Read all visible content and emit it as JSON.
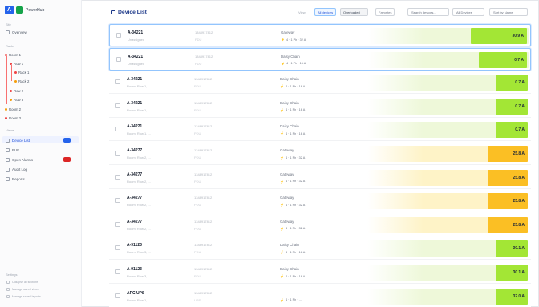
{
  "app": {
    "title": "PowerHub"
  },
  "sidebar": {
    "section_top": "Site",
    "overview": "Overview",
    "section_racks": "Racks",
    "tree": [
      {
        "label": "Room 1",
        "level": 0,
        "dot": "red",
        "count": ""
      },
      {
        "label": "Row 1",
        "level": 1,
        "dot": "red",
        "count": ""
      },
      {
        "label": "Rack 1",
        "level": 2,
        "dot": "red",
        "count": ""
      },
      {
        "label": "Rack 2",
        "level": 2,
        "dot": "orange",
        "count": ""
      },
      {
        "label": "Row 2",
        "level": 1,
        "dot": "red",
        "count": ""
      },
      {
        "label": "Row 3",
        "level": 1,
        "dot": "orange",
        "count": ""
      },
      {
        "label": "Room 2",
        "level": 0,
        "dot": "orange",
        "count": ""
      },
      {
        "label": "Room 3",
        "level": 0,
        "dot": "red",
        "count": ""
      }
    ],
    "section_views": "Views",
    "nav": [
      {
        "label": "Device List",
        "badge": "",
        "badge_color": "blue",
        "active": true
      },
      {
        "label": "PUE",
        "badge": "",
        "badge_color": "",
        "active": false
      },
      {
        "label": "Open Alarms",
        "badge": "",
        "badge_color": "red",
        "active": false
      },
      {
        "label": "Audit Log",
        "badge": "",
        "badge_color": "",
        "active": false
      },
      {
        "label": "Reports",
        "badge": "",
        "badge_color": "",
        "active": false
      }
    ],
    "section_settings": "Settings",
    "footer": [
      "Collapse all sections",
      "Manage saved views",
      "Manage saved layouts"
    ]
  },
  "header": {
    "title": "Device List",
    "view_label": "View",
    "seg_all": "All devices",
    "seg_overloaded": "Overloaded",
    "seg_overloaded_count": "",
    "seg_favorites": "Favorites",
    "search_placeholder": "Search devices...",
    "filter_label": "All Devices",
    "sort_label": "Sort by Name"
  },
  "rows": [
    {
      "name": "A-34221",
      "loc": "Unassigned",
      "serial": "1348917812",
      "sub": "PDU",
      "type": "Gateway",
      "spec": "4 · 1 Ph · 32 A",
      "value": "30.9 A",
      "fill": 0.35,
      "tone": "green",
      "selected": true
    },
    {
      "name": "A-34221",
      "loc": "Unassigned",
      "serial": "1348917812",
      "sub": "PDU",
      "type": "Daisy Chain",
      "spec": "4 · 1 Ph · 16 A",
      "value": "0.7 A",
      "fill": 0.3,
      "tone": "green",
      "selected": true
    },
    {
      "name": "A-34221",
      "loc": "Room, Row 1, ...",
      "serial": "1348917812",
      "sub": "PDU",
      "type": "Daisy Chain",
      "spec": "4 · 1 Ph · 16 A",
      "value": "0.7 A",
      "fill": 0.2,
      "tone": "green",
      "selected": false
    },
    {
      "name": "A-34221",
      "loc": "Room, Row 1, ...",
      "serial": "1348917812",
      "sub": "PDU",
      "type": "Daisy Chain",
      "spec": "4 · 1 Ph · 16 A",
      "value": "0.7 A",
      "fill": 0.2,
      "tone": "green",
      "selected": false
    },
    {
      "name": "A-34221",
      "loc": "Room, Row 1, ...",
      "serial": "1348917812",
      "sub": "PDU",
      "type": "Daisy Chain",
      "spec": "4 · 1 Ph · 16 A",
      "value": "0.7 A",
      "fill": 0.2,
      "tone": "green",
      "selected": false
    },
    {
      "name": "A-34277",
      "loc": "Room, Row 2, ...",
      "serial": "1348917812",
      "sub": "PDU",
      "type": "Gateway",
      "spec": "4 · 1 Ph · 32 A",
      "value": "25.8 A",
      "fill": 0.25,
      "tone": "yellow",
      "selected": false
    },
    {
      "name": "A-34277",
      "loc": "Room, Row 2, ...",
      "serial": "1348917812",
      "sub": "PDU",
      "type": "Gateway",
      "spec": "4 · 1 Ph · 32 A",
      "value": "25.8 A",
      "fill": 0.25,
      "tone": "yellow",
      "selected": false
    },
    {
      "name": "A-34277",
      "loc": "Room, Row 2, ...",
      "serial": "1348917812",
      "sub": "PDU",
      "type": "Gateway",
      "spec": "4 · 1 Ph · 32 A",
      "value": "25.8 A",
      "fill": 0.25,
      "tone": "yellow",
      "selected": false
    },
    {
      "name": "A-34277",
      "loc": "Room, Row 2, ...",
      "serial": "1348917812",
      "sub": "PDU",
      "type": "Gateway",
      "spec": "4 · 1 Ph · 32 A",
      "value": "25.8 A",
      "fill": 0.25,
      "tone": "yellow",
      "selected": false
    },
    {
      "name": "A-91123",
      "loc": "Room, Row 3, ...",
      "serial": "1348917812",
      "sub": "PDU",
      "type": "Daisy Chain",
      "spec": "4 · 1 Ph · 16 A",
      "value": "30.1 A",
      "fill": 0.2,
      "tone": "green",
      "selected": false
    },
    {
      "name": "A-91123",
      "loc": "Room, Row 3, ...",
      "serial": "1348917812",
      "sub": "PDU",
      "type": "Daisy Chain",
      "spec": "4 · 1 Ph · 16 A",
      "value": "30.1 A",
      "fill": 0.2,
      "tone": "green",
      "selected": false
    },
    {
      "name": "APC UPS",
      "loc": "Room, Row 1, ...",
      "serial": "1348917812",
      "sub": "UPS",
      "type": "",
      "spec": "4 · 1 Ph · ...",
      "value": "32.0 A",
      "fill": 0.2,
      "tone": "green",
      "selected": false
    }
  ],
  "colors": {
    "accent": "#2563eb",
    "green_light": "#eef8d9",
    "green_strong": "#a3e635",
    "yellow_light": "#fef3c7",
    "yellow_strong": "#fbbf24",
    "alarm": "#dc2626"
  }
}
